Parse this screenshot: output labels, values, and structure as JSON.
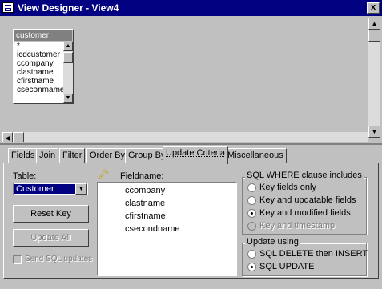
{
  "window": {
    "title": "View Designer - View4",
    "close_label": "x"
  },
  "table_box": {
    "name": "customer",
    "fields": [
      "*",
      "icdcustomer",
      "ccompany",
      "clastname",
      "cfirstname",
      "cseconmame"
    ]
  },
  "tabs": [
    {
      "label": "Fields"
    },
    {
      "label": "Join"
    },
    {
      "label": "Filter"
    },
    {
      "label": "Order By"
    },
    {
      "label": "Group By"
    },
    {
      "label": "Update Criteria"
    },
    {
      "label": "Miscellaneous"
    }
  ],
  "update_criteria": {
    "table_label": "Table:",
    "table_value": "Customer",
    "reset_key_label": "Reset Key",
    "update_all_label": "Update All",
    "send_sql_label": "Send SQL updates",
    "fieldname_label": "Fieldname:",
    "fields": [
      "ccompany",
      "clastname",
      "cfirstname",
      "csecondname"
    ],
    "where_group": {
      "title": "SQL WHERE clause includes",
      "options": [
        {
          "label": "Key fields only",
          "selected": false,
          "enabled": true
        },
        {
          "label": "Key and updatable fields",
          "selected": false,
          "enabled": true
        },
        {
          "label": "Key and modified fields",
          "selected": true,
          "enabled": true
        },
        {
          "label": "Key and timestamp",
          "selected": false,
          "enabled": false
        }
      ]
    },
    "update_group": {
      "title": "Update using",
      "options": [
        {
          "label": "SQL DELETE then INSERT",
          "selected": false
        },
        {
          "label": "SQL UPDATE",
          "selected": true
        }
      ]
    }
  },
  "icons": {
    "key": "key-icon",
    "dropdown": "chevron-down-icon"
  }
}
